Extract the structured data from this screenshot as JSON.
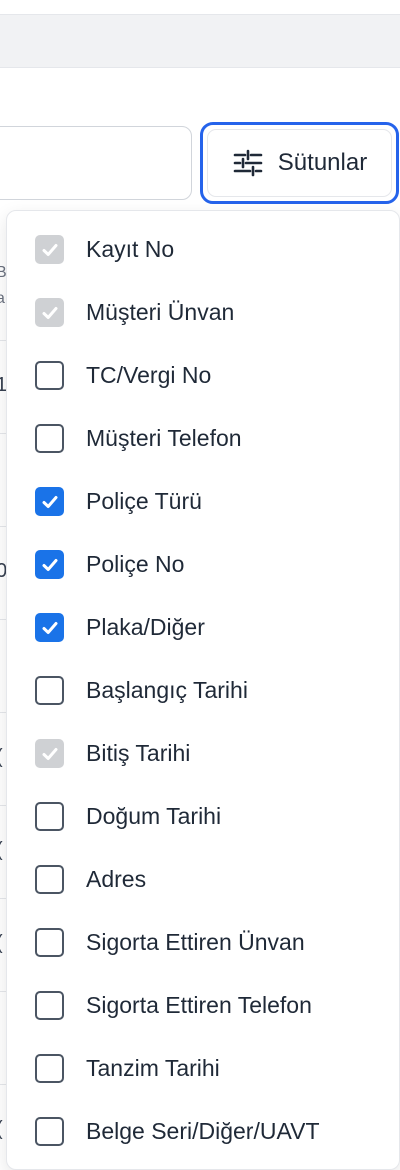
{
  "toolbar": {
    "search_value": "",
    "columns_button_label": "Sütunlar",
    "columns_button_icon": "sliders-icon",
    "accent_color": "#2563eb"
  },
  "table_edge": {
    "header_chars": [
      "B",
      "a"
    ],
    "row_chars": [
      "1",
      ".",
      "0",
      ".",
      "(",
      "(",
      "(",
      ".",
      "("
    ]
  },
  "column_menu": {
    "items": [
      {
        "label": "Kayıt No",
        "checked": true,
        "disabled": true
      },
      {
        "label": "Müşteri Ünvan",
        "checked": true,
        "disabled": true
      },
      {
        "label": "TC/Vergi No",
        "checked": false,
        "disabled": false
      },
      {
        "label": "Müşteri Telefon",
        "checked": false,
        "disabled": false
      },
      {
        "label": "Poliçe Türü",
        "checked": true,
        "disabled": false
      },
      {
        "label": "Poliçe No",
        "checked": true,
        "disabled": false
      },
      {
        "label": "Plaka/Diğer",
        "checked": true,
        "disabled": false
      },
      {
        "label": "Başlangıç Tarihi",
        "checked": false,
        "disabled": false
      },
      {
        "label": "Bitiş Tarihi",
        "checked": true,
        "disabled": true
      },
      {
        "label": "Doğum Tarihi",
        "checked": false,
        "disabled": false
      },
      {
        "label": "Adres",
        "checked": false,
        "disabled": false
      },
      {
        "label": "Sigorta Ettiren Ünvan",
        "checked": false,
        "disabled": false
      },
      {
        "label": "Sigorta Ettiren Telefon",
        "checked": false,
        "disabled": false
      },
      {
        "label": "Tanzim Tarihi",
        "checked": false,
        "disabled": false
      },
      {
        "label": "Belge Seri/Diğer/UAVT",
        "checked": false,
        "disabled": false
      }
    ],
    "checked_color": "#1a73e8",
    "disabled_color": "#cfd1d4"
  }
}
